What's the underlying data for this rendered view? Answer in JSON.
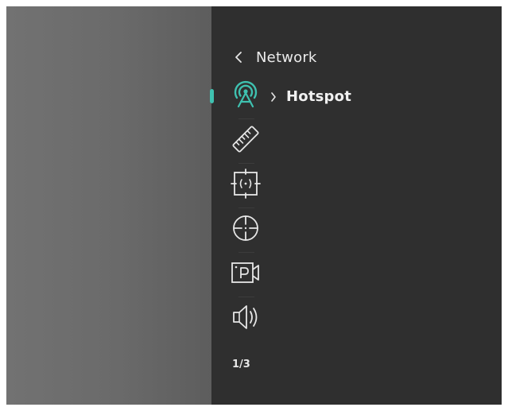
{
  "header": {
    "title": "Network"
  },
  "submenu": {
    "label": "Hotspot"
  },
  "pager": {
    "text": "1/3"
  },
  "menu": {
    "items": [
      {
        "name": "hotspot",
        "icon": "hotspot-icon",
        "active": true
      },
      {
        "name": "ruler",
        "icon": "ruler-icon"
      },
      {
        "name": "target-center",
        "icon": "target-center-icon"
      },
      {
        "name": "crosshair",
        "icon": "crosshair-icon"
      },
      {
        "name": "picture-in-picture",
        "icon": "pip-camera-icon"
      },
      {
        "name": "audio",
        "icon": "speaker-icon"
      }
    ]
  },
  "colors": {
    "accent": "#3fc1b0",
    "panel": "#2f2f2f",
    "text": "#ececec"
  }
}
